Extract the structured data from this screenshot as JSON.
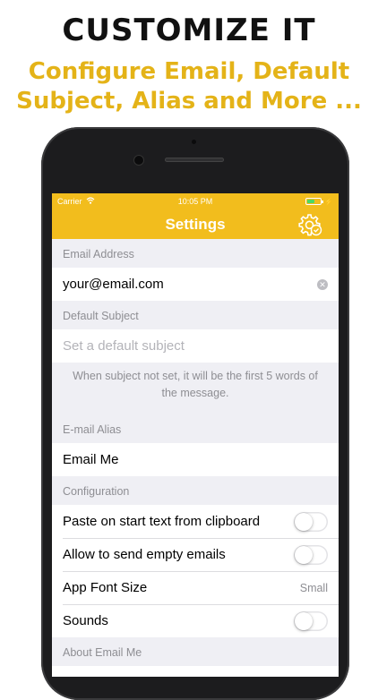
{
  "promo": {
    "headline": "CUSTOMIZE IT",
    "tagline_line1": "Configure Email, Default",
    "tagline_line2": "Subject, Alias and More ..."
  },
  "status_bar": {
    "carrier": "Carrier",
    "time": "10:05 PM",
    "battery_color": "#4cd964"
  },
  "nav": {
    "title": "Settings",
    "settings_icon": "gear-check-icon",
    "bar_color": "#f2bd1d"
  },
  "email_section": {
    "header": "Email Address",
    "value": "your@email.com"
  },
  "subject_section": {
    "header": "Default Subject",
    "placeholder": "Set a default subject",
    "footer": "When subject not set, it will be the first 5 words of the message."
  },
  "alias_section": {
    "header": "E-mail Alias",
    "value": "Email Me"
  },
  "configuration": {
    "header": "Configuration",
    "rows": [
      {
        "label": "Paste on start text from clipboard",
        "toggle": false
      },
      {
        "label": "Allow to send empty emails",
        "toggle": false
      },
      {
        "label": "App Font Size",
        "detail": "Small"
      },
      {
        "label": "Sounds",
        "toggle": false
      }
    ]
  },
  "about_section": {
    "header": "About Email Me"
  }
}
